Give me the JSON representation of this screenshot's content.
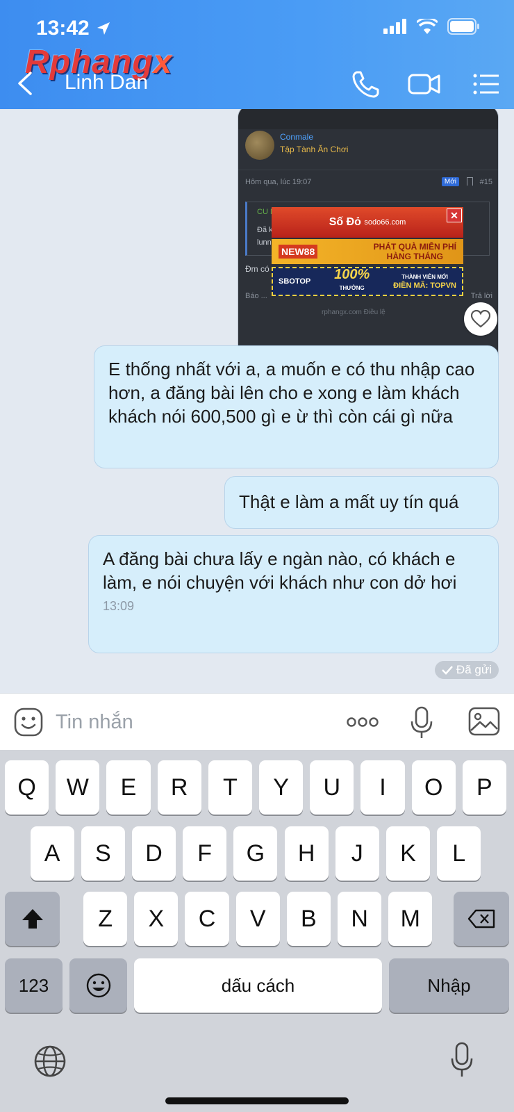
{
  "status_bar": {
    "time": "13:42"
  },
  "watermark": {
    "main": "Rphang",
    "accent": "x"
  },
  "header": {
    "contact_name": "Linh Dan"
  },
  "shared_image": {
    "username": "Conmale",
    "user_title": "Tập Tành Ăn Chơi",
    "post_date": "Hôm qua, lúc 19:07",
    "new_badge": "Mới",
    "post_number": "#15",
    "quote_line1": "CU MẶT ...",
    "quote_line2": "Đã k...",
    "quote_line3": "lunn...",
    "body_text": "Đm có ...",
    "report_label": "Báo ...",
    "reply_label": "Trả lời",
    "footer": "rphangx.com    Điều lệ",
    "ads": {
      "ad1_brand": "Số Đỏ",
      "ad1_sub": "sodo66.com",
      "ad2_brand": "NEW88",
      "ad2_line1": "PHÁT QUÀ MIỄN PHÍ",
      "ad2_line2": "HÀNG THÁNG",
      "ad3_brand": "SBOTOP",
      "ad3_big": "100%",
      "ad3_small": "THƯỞNG",
      "ad3_line1": "THÀNH VIÊN MỚI",
      "ad3_code": "ĐIỀN MÃ: TOPVN"
    }
  },
  "messages": [
    {
      "text": "E thống nhất với a, a muốn e có thu nhập cao hơn, a đăng bài lên cho e xong e làm khách khách nói 600,500 gì e ừ thì còn cái gì nữa"
    },
    {
      "text": "Thật e làm a mất uy tín quá"
    },
    {
      "text": "A đăng bài chưa lấy e ngàn nào, có khách e làm, e nói chuyện với khách như con dở hơi",
      "time": "13:09"
    }
  ],
  "sent_status": "Đã gửi",
  "input": {
    "placeholder": "Tin nhắn"
  },
  "keyboard": {
    "row1": [
      "Q",
      "W",
      "E",
      "R",
      "T",
      "Y",
      "U",
      "I",
      "O",
      "P"
    ],
    "row2": [
      "A",
      "S",
      "D",
      "F",
      "G",
      "H",
      "J",
      "K",
      "L"
    ],
    "row3": [
      "Z",
      "X",
      "C",
      "V",
      "B",
      "N",
      "M"
    ],
    "numbers_key": "123",
    "space_key": "dấu cách",
    "return_key": "Nhập"
  },
  "icons": {
    "back": "chevron-left-icon",
    "call": "phone-icon",
    "video": "video-camera-icon",
    "menu": "list-menu-icon",
    "heart": "heart-icon",
    "emoji": "emoji-icon",
    "more": "more-dots-icon",
    "mic": "microphone-icon",
    "image": "image-icon",
    "shift": "shift-icon",
    "delete": "backspace-icon",
    "globe": "globe-icon"
  },
  "colors": {
    "header": "#4a9cf5",
    "bubble": "#d6eefb",
    "chat_bg": "#e3e9f1",
    "keyboard_bg": "#d1d4da"
  }
}
